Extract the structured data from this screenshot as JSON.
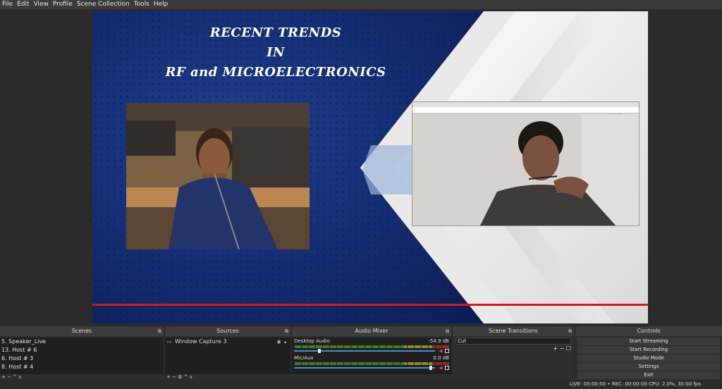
{
  "menu": [
    "File",
    "Edit",
    "View",
    "Profile",
    "Scene Collection",
    "Tools",
    "Help"
  ],
  "preview": {
    "title_lines": [
      "RECENT TRENDS",
      "IN",
      "RF and MICROELECTRONICS"
    ],
    "right_cam_time": "12:51 PM"
  },
  "docks": {
    "scenes": {
      "title": "Scenes",
      "items": [
        "5. Speaker_Live",
        "13. Host # 6",
        "6. Host # 3",
        "8. Host # 4"
      ],
      "footer": "+ − ^ v"
    },
    "sources": {
      "title": "Sources",
      "items": [
        "Window Capture 3"
      ],
      "footer": "+ − ⚙ ^ v"
    },
    "mixer": {
      "title": "Audio Mixer",
      "channels": [
        {
          "name": "Desktop Audio",
          "db": "-54.9 dB",
          "fader": 0.18
        },
        {
          "name": "Mic/Aux",
          "db": "0.0 dB",
          "fader": 0.97
        }
      ]
    },
    "transitions": {
      "title": "Scene Transitions",
      "selected": "Cut",
      "buttons": "+ − ☐"
    },
    "controls": {
      "title": "Controls",
      "buttons": [
        "Start Streaming",
        "Start Recording",
        "Studio Mode",
        "Settings",
        "Exit"
      ]
    }
  },
  "status": {
    "text": "LIVE: 00:00:00 • REC: 00:00:00 CPU: 2.0%, 30.00 fps"
  },
  "colors": {
    "accent_red": "#d11b1b",
    "background": "#2b2b2b",
    "panel": "#1f1f1f",
    "slide_blue": "#152f76"
  }
}
